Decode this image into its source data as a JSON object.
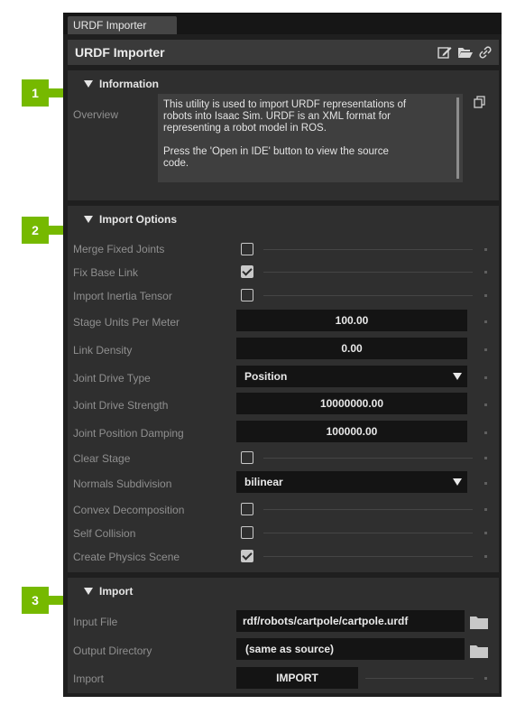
{
  "tab": {
    "label": "URDF Importer"
  },
  "window": {
    "title": "URDF Importer",
    "icons": [
      "edit-icon",
      "folder-open-icon",
      "link-icon"
    ]
  },
  "badges": [
    "1",
    "2",
    "3"
  ],
  "accent_color": "#76b900",
  "information": {
    "header": "Information",
    "overview_label": "Overview",
    "overview_line1": "This utility is used to import URDF representations of",
    "overview_line2": "robots into Isaac Sim. URDF is an XML format for",
    "overview_line3": "representing a robot model in ROS.",
    "overview_line4": "Press the 'Open in IDE' button to view the source",
    "overview_line5": "code."
  },
  "import_options": {
    "header": "Import Options",
    "merge_fixed_joints": {
      "label": "Merge Fixed Joints",
      "checked": false
    },
    "fix_base_link": {
      "label": "Fix Base Link",
      "checked": true
    },
    "import_inertia_tensor": {
      "label": "Import Inertia Tensor",
      "checked": false
    },
    "stage_units_per_meter": {
      "label": "Stage Units Per Meter",
      "value": "100.00"
    },
    "link_density": {
      "label": "Link Density",
      "value": "0.00"
    },
    "joint_drive_type": {
      "label": "Joint Drive Type",
      "value": "Position"
    },
    "joint_drive_strength": {
      "label": "Joint Drive Strength",
      "value": "10000000.00"
    },
    "joint_position_damping": {
      "label": "Joint Position Damping",
      "value": "100000.00"
    },
    "clear_stage": {
      "label": "Clear Stage",
      "checked": false
    },
    "normals_subdivision": {
      "label": "Normals Subdivision",
      "value": "bilinear"
    },
    "convex_decomposition": {
      "label": "Convex Decomposition",
      "checked": false
    },
    "self_collision": {
      "label": "Self Collision",
      "checked": false
    },
    "create_physics_scene": {
      "label": "Create Physics Scene",
      "checked": true
    }
  },
  "import": {
    "header": "Import",
    "input_file_label": "Input File",
    "input_file_value": "rdf/robots/cartpole/cartpole.urdf",
    "output_directory_label": "Output Directory",
    "output_directory_value": "(same as source)",
    "import_label": "Import",
    "import_button": "IMPORT"
  }
}
